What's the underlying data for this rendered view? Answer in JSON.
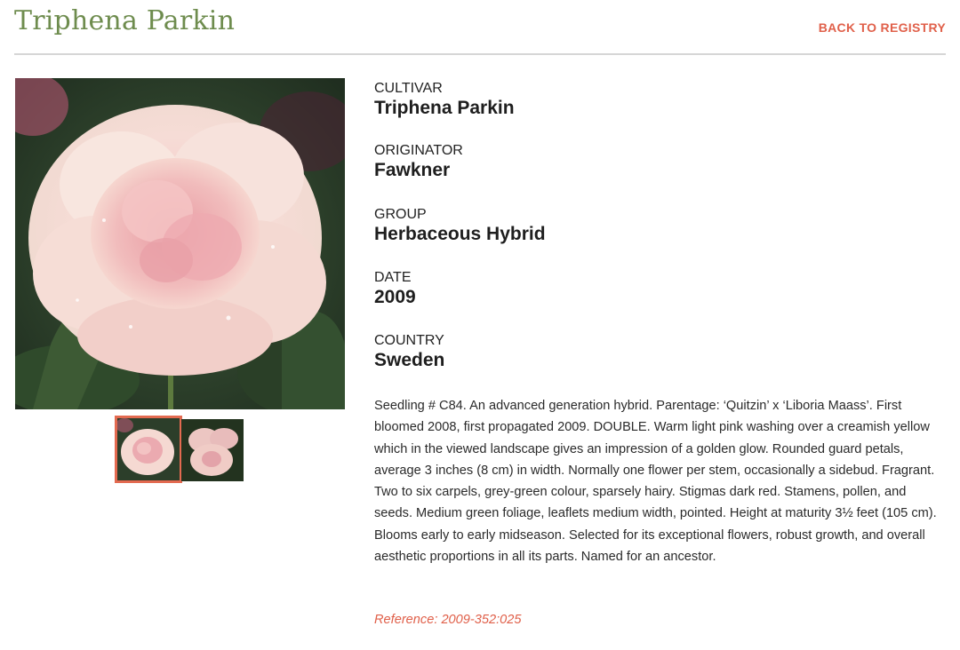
{
  "header": {
    "title": "Triphena Parkin",
    "back_link": "BACK TO REGISTRY"
  },
  "fields": [
    {
      "label": "CULTIVAR",
      "value": "Triphena Parkin"
    },
    {
      "label": "ORIGINATOR",
      "value": "Fawkner"
    },
    {
      "label": "GROUP",
      "value": "Herbaceous Hybrid"
    },
    {
      "label": "DATE",
      "value": "2009"
    },
    {
      "label": "COUNTRY",
      "value": "Sweden"
    }
  ],
  "description": "Seedling # C84. An advanced generation hybrid. Parentage: ‘Quitzin’ x ‘Liboria Maass’. First bloomed 2008, first propagated 2009. DOUBLE. Warm light pink washing over a creamish yellow which in the viewed landscape gives an impression of a golden glow. Rounded guard petals, average 3 inches (8 cm) in width. Normally one flower per stem, occasionally a sidebud. Fragrant. Two to six carpels, grey-green colour, sparsely hairy. Stigmas dark red. Stamens, pollen, and seeds. Medium green foliage, leaflets medium width, pointed. Height at maturity 3½ feet (105 cm). Blooms early to early midseason. Selected for its exceptional flowers, robust growth, and overall aesthetic proportions in all its parts. Named for an ancestor.",
  "reference": "Reference: 2009-352:025",
  "gallery": {
    "selected_index": 0,
    "thumbnail_count": 2
  },
  "colors": {
    "title": "#6e8c4e",
    "accent": "#e0604a",
    "thumb_selected_border": "#e36a50"
  }
}
